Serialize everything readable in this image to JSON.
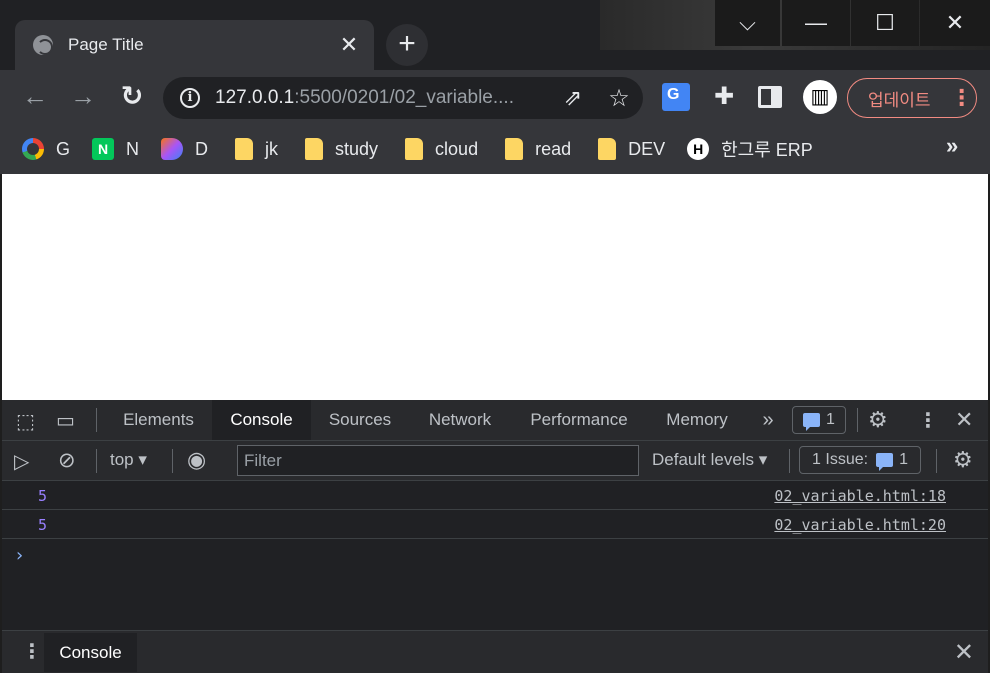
{
  "window": {
    "controls": {
      "tab_search": "⌵",
      "minimize": "—",
      "maximize": "☐",
      "close": "✕"
    }
  },
  "tab": {
    "title": "Page Title",
    "close": "✕",
    "new_tab": "+"
  },
  "toolbar": {
    "back": "←",
    "forward": "→",
    "reload": "↻",
    "url_host": "127.0.0.1",
    "url_rest": ":5500/0201/02_variable....",
    "update_label": "업데이트"
  },
  "bookmarks": [
    {
      "label": "G",
      "icon": "google-icon"
    },
    {
      "label": "N",
      "icon": "naver-icon"
    },
    {
      "label": "D",
      "icon": "d-app-icon"
    },
    {
      "label": "jk",
      "icon": "folder-icon"
    },
    {
      "label": "study",
      "icon": "folder-icon"
    },
    {
      "label": "cloud",
      "icon": "folder-icon"
    },
    {
      "label": "read",
      "icon": "folder-icon"
    },
    {
      "label": "DEV",
      "icon": "folder-icon"
    },
    {
      "label": "한그루 ERP",
      "icon": "erp-icon"
    }
  ],
  "bookmarks_more": "»",
  "devtools": {
    "tabs": [
      "Elements",
      "Console",
      "Sources",
      "Network",
      "Performance",
      "Memory"
    ],
    "active_tab": "Console",
    "more_tabs": "»",
    "issues_count": "1",
    "context": "top",
    "filter_placeholder": "Filter",
    "levels": "Default levels",
    "issue_label": "1 Issue:",
    "issue_count": "1",
    "messages": [
      {
        "value": "5",
        "source": "02_variable.html:18"
      },
      {
        "value": "5",
        "source": "02_variable.html:20"
      }
    ],
    "prompt": "›",
    "drawer_tab": "Console"
  }
}
